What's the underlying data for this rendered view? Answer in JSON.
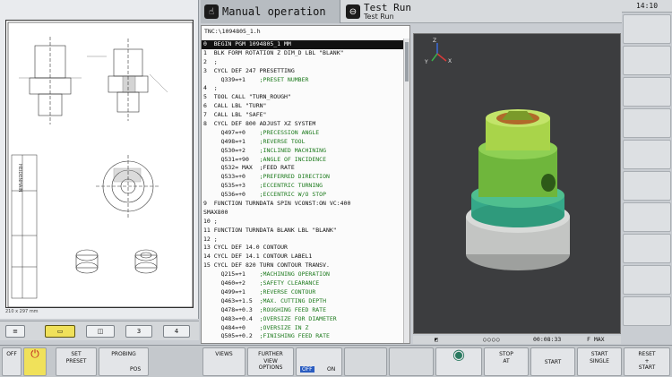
{
  "topbar": {
    "primary_mode": "Manual operation",
    "secondary_mode": "Test Run",
    "secondary_sub": "Test Run",
    "clock": "14:10"
  },
  "drawing": {
    "paper_size": "210 x 297 mm",
    "company": "HEIDENHAIN"
  },
  "program": {
    "path": "TNC:\\1094805_1.h",
    "lines": [
      {
        "code": "0  BEGIN PGM 1094805_1 MM",
        "comment": "",
        "selected": true
      },
      {
        "code": "1  BLK FORM ROTATION Z DIM_D LBL \"BLANK\"",
        "comment": ""
      },
      {
        "code": "2  ;",
        "comment": ""
      },
      {
        "code": "3  CYCL DEF 247 PRESETTING",
        "comment": ""
      },
      {
        "code": "     Q339=+1    ",
        "comment": ";PRESET NUMBER"
      },
      {
        "code": "4  ;",
        "comment": ""
      },
      {
        "code": "5  TOOL CALL \"TURN_ROUGH\"",
        "comment": ""
      },
      {
        "code": "6  CALL LBL \"TURN\"",
        "comment": ""
      },
      {
        "code": "7  CALL LBL \"SAFE\"",
        "comment": ""
      },
      {
        "code": "8  CYCL DEF 800 ADJUST XZ SYSTEM",
        "comment": ""
      },
      {
        "code": "     Q497=+0    ",
        "comment": ";PRECESSION ANGLE"
      },
      {
        "code": "     Q498=+1    ",
        "comment": ";REVERSE TOOL"
      },
      {
        "code": "     Q530=+2    ",
        "comment": ";INCLINED MACHINING"
      },
      {
        "code": "     Q531=+90   ",
        "comment": ";ANGLE OF INCIDENCE"
      },
      {
        "code": "     Q532= MAX  ;FEED RATE",
        "comment": ""
      },
      {
        "code": "     Q533=+0    ",
        "comment": ";PREFERRED DIRECTION"
      },
      {
        "code": "     Q535=+3    ",
        "comment": ";ECCENTRIC TURNING"
      },
      {
        "code": "     Q536=+0    ",
        "comment": ";ECCENTRIC W/O STOP"
      },
      {
        "code": "9  FUNCTION TURNDATA SPIN VCONST:ON VC:400",
        "comment": ""
      },
      {
        "code": "SMAX800",
        "comment": ""
      },
      {
        "code": "10 ;",
        "comment": ""
      },
      {
        "code": "11 FUNCTION TURNDATA BLANK LBL \"BLANK\"",
        "comment": ""
      },
      {
        "code": "12 ;",
        "comment": ""
      },
      {
        "code": "13 CYCL DEF 14.0 CONTOUR",
        "comment": ""
      },
      {
        "code": "14 CYCL DEF 14.1 CONTOUR LABEL1",
        "comment": ""
      },
      {
        "code": "15 CYCL DEF 820 TURN CONTOUR TRANSV.",
        "comment": ""
      },
      {
        "code": "     Q215=+1    ",
        "comment": ";MACHINING OPERATION"
      },
      {
        "code": "     Q460=+2    ",
        "comment": ";SAFETY CLEARANCE"
      },
      {
        "code": "     Q499=+1    ",
        "comment": ";REVERSE CONTOUR"
      },
      {
        "code": "     Q463=+1.5  ",
        "comment": ";MAX. CUTTING DEPTH"
      },
      {
        "code": "     Q478=+0.3  ",
        "comment": ";ROUGHING FEED RATE"
      },
      {
        "code": "     Q483=+0.4  ",
        "comment": ";OVERSIZE FOR DIAMETER"
      },
      {
        "code": "     Q484=+0    ",
        "comment": ";OVERSIZE IN Z"
      },
      {
        "code": "     Q505=+0.2  ",
        "comment": ";FINISHING FEED RATE"
      }
    ]
  },
  "view3d": {
    "axis_x": "X",
    "axis_y": "Y",
    "axis_z": "Z",
    "time": "00:08:33",
    "feed": "F MAX"
  },
  "left_buttons": {
    "menu_label": "≡",
    "b3": "3",
    "b4": "4"
  },
  "softkeys": {
    "off_label": "OFF",
    "set_preset": "SET\nPRESET",
    "probing": "PROBING",
    "pos": "POS",
    "views": "VIEWS",
    "further_view": "FURTHER\nVIEW\nOPTIONS",
    "off2": "OFF",
    "on": "ON",
    "stop_at": "STOP\nAT",
    "start": "START",
    "start_single": "START\nSINGLE",
    "reset_start": "RESET\n+\nSTART"
  },
  "colors": {
    "part_green": "#7bc142",
    "part_gray": "#c7c9c7",
    "part_copper": "#b06a2a",
    "highlight_yellow": "#f0e15a"
  }
}
